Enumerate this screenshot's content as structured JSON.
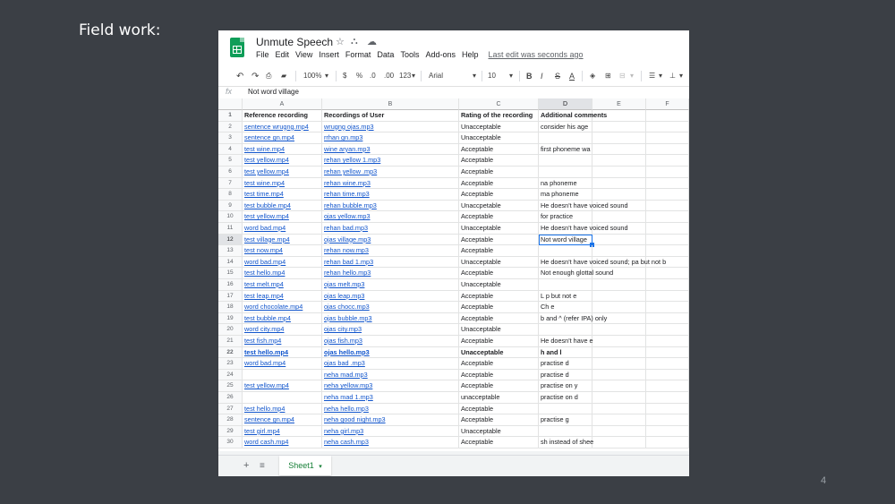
{
  "slide": {
    "title": "Field work:",
    "page_number": "4"
  },
  "app": {
    "doc_title": "Unmute Speech",
    "menu": [
      "File",
      "Edit",
      "View",
      "Insert",
      "Format",
      "Data",
      "Tools",
      "Add-ons",
      "Help"
    ],
    "last_edit": "Last edit was seconds ago",
    "toolbar": {
      "zoom": "100%",
      "currency": "$",
      "percent": "%",
      "dec_less": ".0",
      "dec_more": ".00",
      "num_format": "123",
      "font": "Arial",
      "font_size": "10",
      "bold": "B",
      "italic": "I",
      "strike": "S",
      "text_color": "A"
    },
    "formula": {
      "fx": "fx",
      "value": "Not word village"
    },
    "columns": [
      "A",
      "B",
      "C",
      "D",
      "E",
      "F"
    ],
    "selected_column": "D",
    "selected_row": "12",
    "header_row": {
      "num": "1",
      "a": "Reference recording",
      "b": "Recordings of User",
      "c": "Rating of the recording",
      "d": "Additional comments"
    },
    "rows": [
      {
        "num": "2",
        "a": "sentence wrugng.mp4",
        "b": "wrugng ojas.mp3",
        "c": "Unacceptable",
        "d": "consider his age"
      },
      {
        "num": "3",
        "a": "sentence gn.mp4",
        "b": "rrhan gn.mp3",
        "c": "Unacceptable",
        "d": ""
      },
      {
        "num": "4",
        "a": "test wine.mp4",
        "b": "wine aryan.mp3",
        "c": "Acceptable",
        "d": "first phoneme wa"
      },
      {
        "num": "5",
        "a": "test yellow.mp4",
        "b": "rehan yellow 1.mp3",
        "c": "Acceptable",
        "d": ""
      },
      {
        "num": "6",
        "a": "test yellow.mp4",
        "b": "rehan yellow .mp3",
        "c": "Acceptable",
        "d": ""
      },
      {
        "num": "7",
        "a": "test wine.mp4",
        "b": "rehan wine.mp3",
        "c": "Acceptable",
        "d": "na phoneme"
      },
      {
        "num": "8",
        "a": "test time.mp4",
        "b": "rehan time.mp3",
        "c": "Acceptable",
        "d": "ma phoneme"
      },
      {
        "num": "9",
        "a": "test bubble.mp4",
        "b": "rehan bubble.mp3",
        "c": "Unaccpetable",
        "d": "He doesn't have voiced sound"
      },
      {
        "num": "10",
        "a": "test yellow.mp4",
        "b": "ojas yellow.mp3",
        "c": "Acceptable",
        "d": "for practice"
      },
      {
        "num": "11",
        "a": "word bad.mp4",
        "b": "rehan bad.mp3",
        "c": "Unacceptable",
        "d": "He doesn't have voiced sound"
      },
      {
        "num": "12",
        "a": "test village.mp4",
        "b": "ojas village.mp3",
        "c": "Acceptable",
        "d": "Not word village"
      },
      {
        "num": "13",
        "a": "test now.mp4",
        "b": "rehan now.mp3",
        "c": "Acceptable",
        "d": ""
      },
      {
        "num": "14",
        "a": "word bad.mp4",
        "b": "rehan bad 1.mp3",
        "c": "Unacceptable",
        "d": "He doesn't have voiced sound; pa but not b"
      },
      {
        "num": "15",
        "a": "test hello.mp4",
        "b": "rehan hello.mp3",
        "c": "Acceptable",
        "d": "Not enough glottal sound"
      },
      {
        "num": "16",
        "a": "test melt.mp4",
        "b": "ojas melt.mp3",
        "c": "Unacceptable",
        "d": ""
      },
      {
        "num": "17",
        "a": "test leap.mp4",
        "b": "ojas leap.mp3",
        "c": "Acceptable",
        "d": "L p but not e"
      },
      {
        "num": "18",
        "a": "word chocolate.mp4",
        "b": "ojas chocc.mp3",
        "c": "Acceptable",
        "d": "Ch e"
      },
      {
        "num": "19",
        "a": "test bubble.mp4",
        "b": "ojas bubble.mp3",
        "c": "Acceptable",
        "d": "b and ^ (refer IPA) only"
      },
      {
        "num": "20",
        "a": "word city.mp4",
        "b": "ojas city.mp3",
        "c": "Unacceptable",
        "d": ""
      },
      {
        "num": "21",
        "a": "test fish.mp4",
        "b": "ojas fish.mp3",
        "c": "Acceptable",
        "d": "He doesn't have e"
      },
      {
        "num": "22",
        "a": "test hello.mp4",
        "b": "ojas hello.mp3",
        "c": "Unacceptable",
        "d": "h and l",
        "bold": true
      },
      {
        "num": "23",
        "a": "word bad.mp4",
        "b": "ojas bad .mp3",
        "c": "Acceptable",
        "d": "practise d"
      },
      {
        "num": "24",
        "a": "",
        "b": "neha mad.mp3",
        "c": "Acceptable",
        "d": "practise d"
      },
      {
        "num": "25",
        "a": "test yellow.mp4",
        "b": "neha yellow.mp3",
        "c": "Acceptable",
        "d": "practise on y"
      },
      {
        "num": "26",
        "a": "",
        "b": "neha mad 1.mp3",
        "c": "unacceptable",
        "d": "practise on d"
      },
      {
        "num": "27",
        "a": "test hello.mp4",
        "b": "neha hello.mp3",
        "c": "Acceptable",
        "d": ""
      },
      {
        "num": "28",
        "a": "sentence gn.mp4",
        "b": "neha good night.mp3",
        "c": "Acceptable",
        "d": "practise g"
      },
      {
        "num": "29",
        "a": "test girl.mp4",
        "b": "neha girl.mp3",
        "c": "Unacceptable",
        "d": ""
      },
      {
        "num": "30",
        "a": "word cash.mp4",
        "b": "neha cash.mp3",
        "c": "Acceptable",
        "d": "sh instead of shee"
      }
    ],
    "sheet_tab": "Sheet1",
    "add_sheet": "+",
    "sheet_list": "≡",
    "tab_caret": "▾"
  }
}
